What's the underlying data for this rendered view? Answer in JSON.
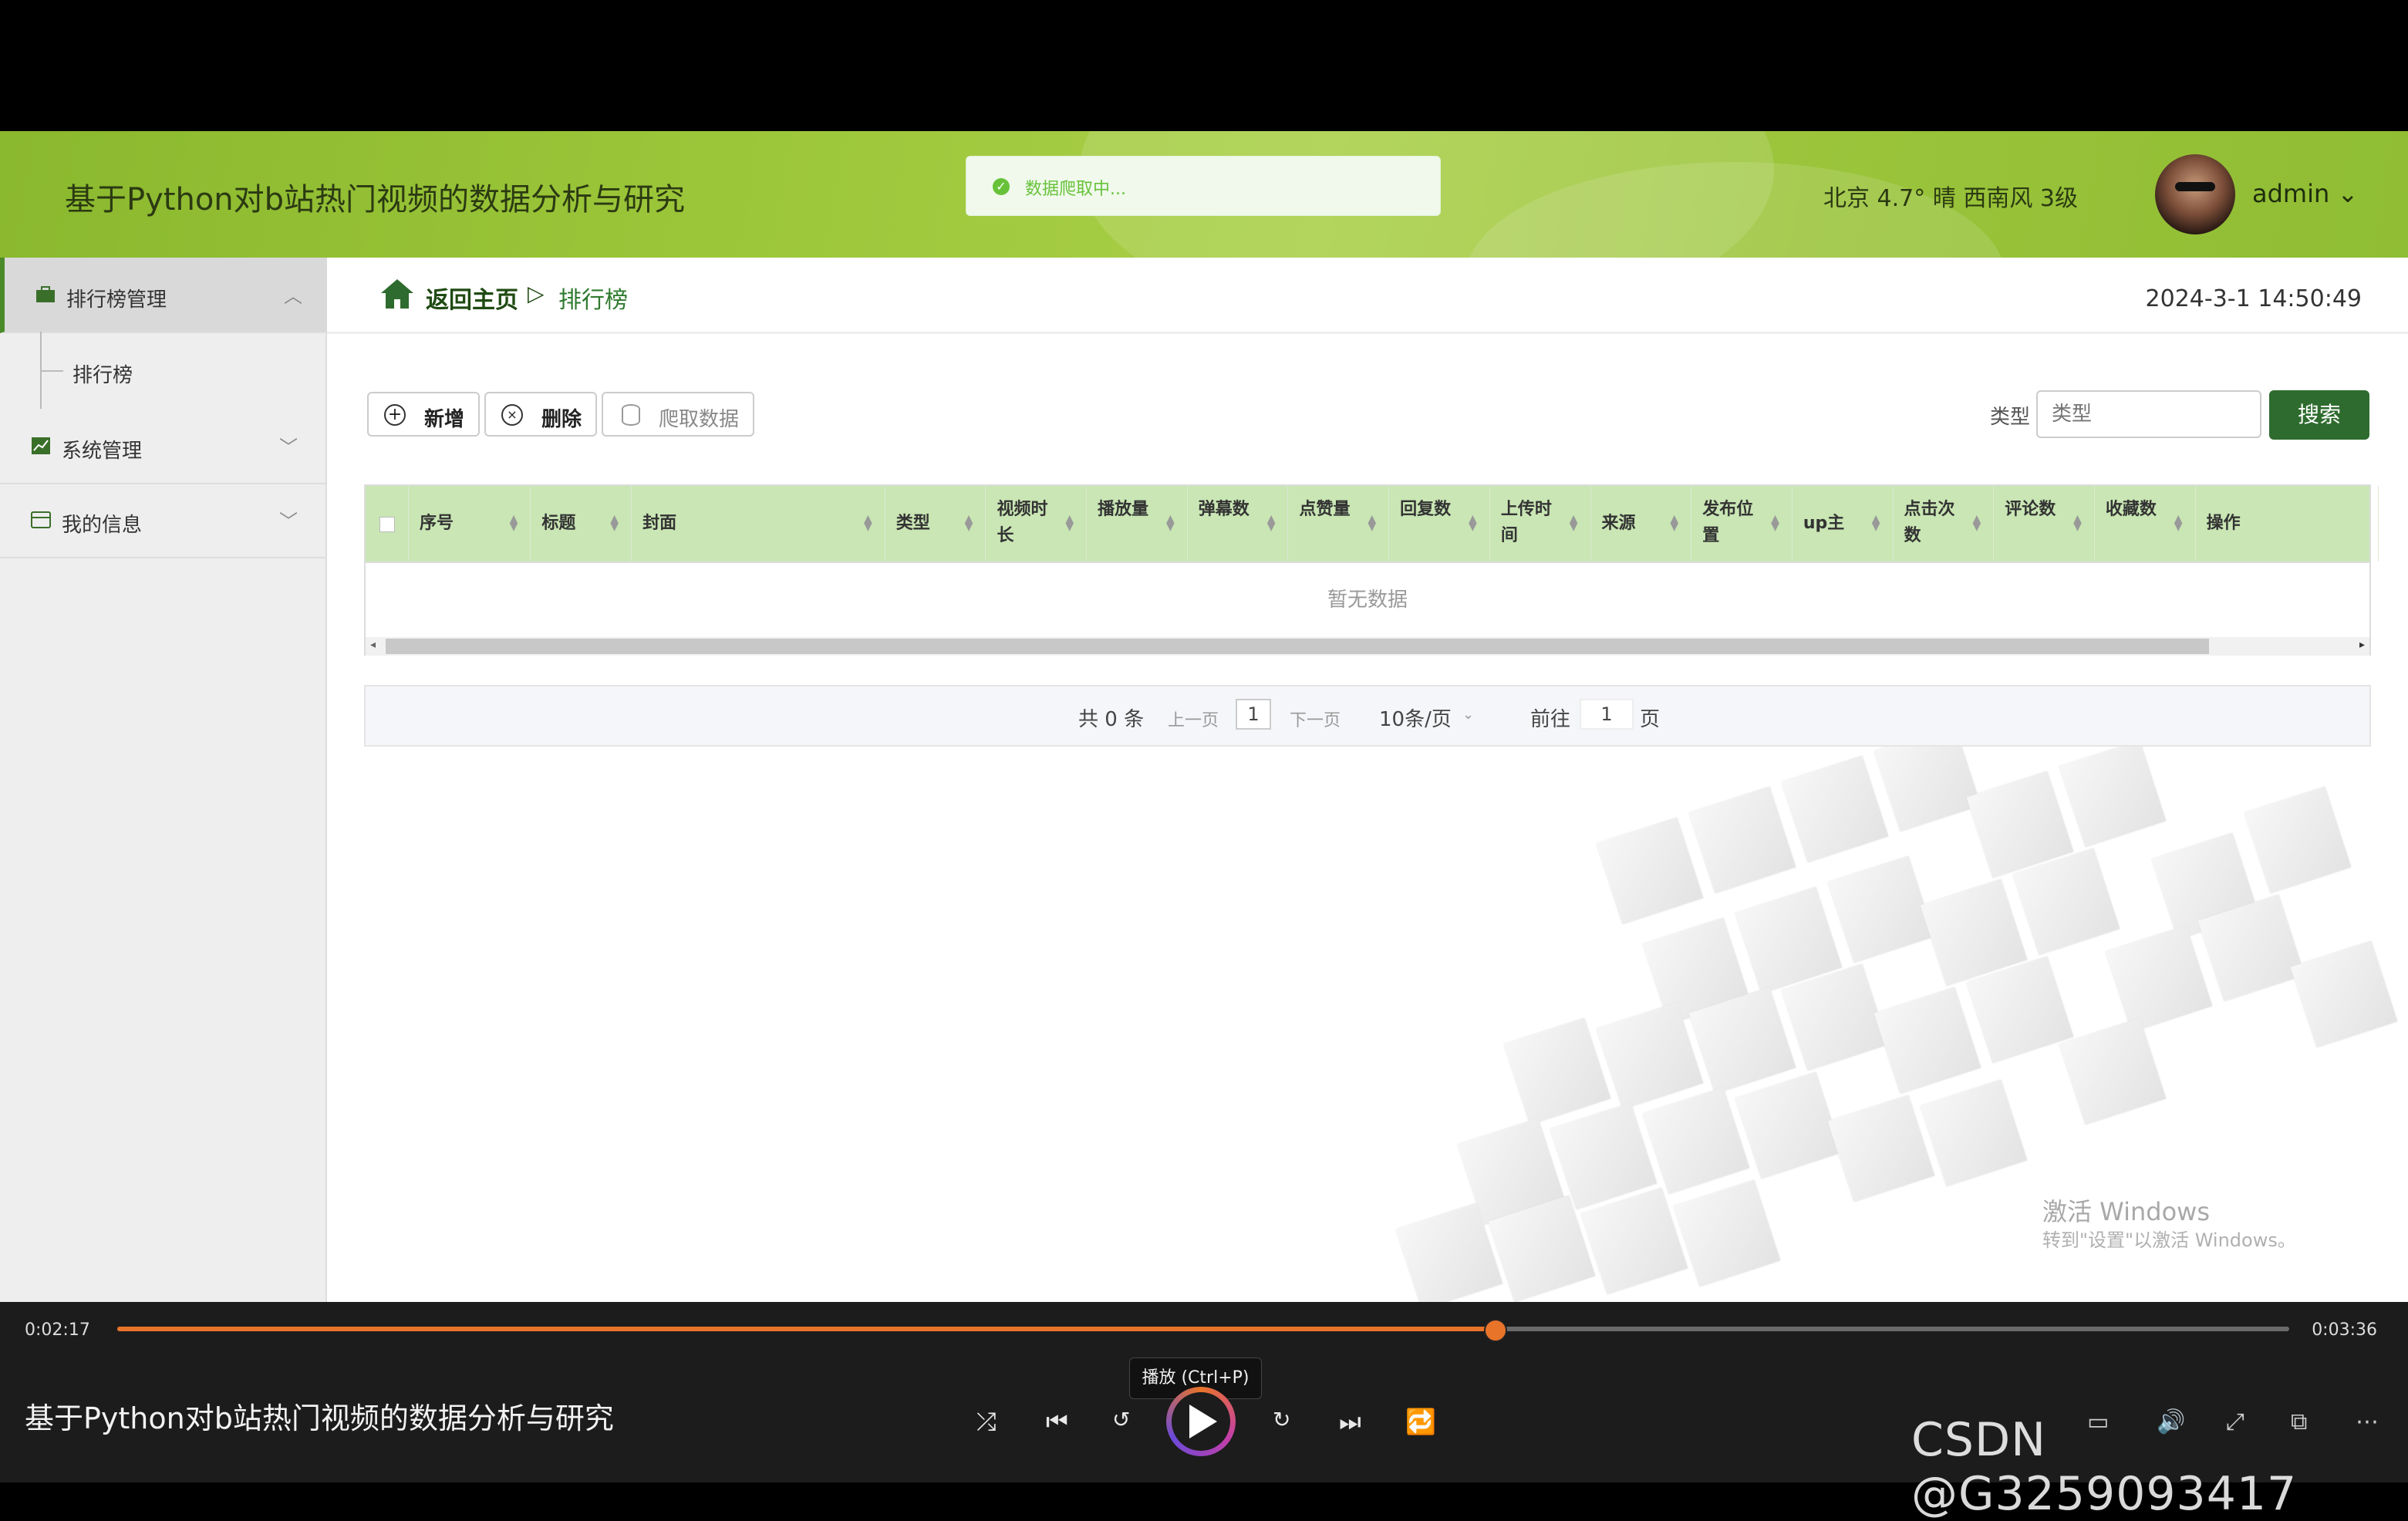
{
  "header": {
    "app_title": "基于Python对b站热门视频的数据分析与研究",
    "toast": "数据爬取中...",
    "weather": "北京 4.7° 晴 西南风 3级",
    "user": "admin ⌄"
  },
  "sidebar": {
    "items": [
      {
        "label": "排行榜管理",
        "icon": "briefcase-icon"
      },
      {
        "label": "排行榜",
        "icon": ""
      },
      {
        "label": "系统管理",
        "icon": "chart-icon"
      },
      {
        "label": "我的信息",
        "icon": "card-icon"
      }
    ]
  },
  "breadcrumb": {
    "home": "返回主页",
    "sep": "▷",
    "current": "排行榜"
  },
  "datetime": "2024-3-1 14:50:49",
  "toolbar": {
    "add": "新增",
    "delete": "删除",
    "crawl": "爬取数据"
  },
  "search": {
    "label": "类型",
    "placeholder": "类型",
    "button": "搜索"
  },
  "table": {
    "headers": [
      "序号",
      "标题",
      "封面",
      "类型",
      "视频时长",
      "播放量",
      "弹幕数",
      "点赞量",
      "回复数",
      "上传时间",
      "来源",
      "发布位置",
      "up主",
      "点击次数",
      "评论数",
      "收藏数",
      "操作"
    ],
    "empty_text": "暂无数据"
  },
  "pager": {
    "total": "共 0 条",
    "prev": "上一页",
    "page": "1",
    "next": "下一页",
    "size": "10条/页",
    "goto": "前往",
    "goto_page": "1",
    "page_unit": "页"
  },
  "watermark": {
    "line1": "激活 Windows",
    "line2": "转到\"设置\"以激活 Windows。"
  },
  "player": {
    "current_time": "0:02:17",
    "total_time": "0:03:36",
    "progress": 0.634,
    "tooltip": "播放 (Ctrl+P)",
    "title": "基于Python对b站热门视频的数据分析与研究",
    "overlay": "CSDN @G3259093417"
  },
  "colors": {
    "header_green": "#9cc63a",
    "accent_green": "#2e6b2e",
    "table_header": "#c9e6b4",
    "progress": "#e8742a"
  }
}
